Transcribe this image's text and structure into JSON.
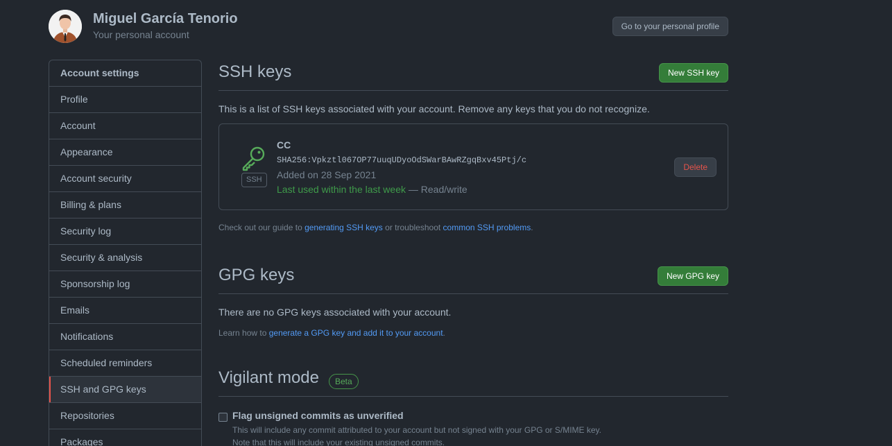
{
  "header": {
    "user_name": "Miguel García Tenorio",
    "subtitle": "Your personal account",
    "profile_button": "Go to your personal profile"
  },
  "sidebar": {
    "heading": "Account settings",
    "items": [
      {
        "label": "Profile"
      },
      {
        "label": "Account"
      },
      {
        "label": "Appearance"
      },
      {
        "label": "Account security"
      },
      {
        "label": "Billing & plans"
      },
      {
        "label": "Security log"
      },
      {
        "label": "Security & analysis"
      },
      {
        "label": "Sponsorship log"
      },
      {
        "label": "Emails"
      },
      {
        "label": "Notifications"
      },
      {
        "label": "Scheduled reminders"
      },
      {
        "label": "SSH and GPG keys",
        "active": true
      },
      {
        "label": "Repositories"
      },
      {
        "label": "Packages"
      }
    ]
  },
  "ssh": {
    "title": "SSH keys",
    "new_button": "New SSH key",
    "intro": "This is a list of SSH keys associated with your account. Remove any keys that you do not recognize.",
    "key": {
      "name": "CC",
      "fingerprint": "SHA256:Vpkztl067OP77uuqUDyoOdSWarBAwRZgqBxv45Ptj/c",
      "added": "Added on 28 Sep 2021",
      "last_used": "Last used within the last week",
      "access": " — Read/write",
      "type_label": "SSH",
      "delete_button": "Delete"
    },
    "note_prefix": "Check out our guide to ",
    "note_link1": "generating SSH keys",
    "note_middle": " or troubleshoot ",
    "note_link2": "common SSH problems",
    "note_suffix": "."
  },
  "gpg": {
    "title": "GPG keys",
    "new_button": "New GPG key",
    "empty": "There are no GPG keys associated with your account.",
    "note_prefix": "Learn how to ",
    "note_link": "generate a GPG key and add it to your account",
    "note_suffix": "."
  },
  "vigilant": {
    "title": "Vigilant mode",
    "badge": "Beta",
    "checkbox_label": "Flag unsigned commits as unverified",
    "desc_line1": "This will include any commit attributed to your account but not signed with your GPG or S/MIME key.",
    "desc_line2": "Note that this will include your existing unsigned commits.",
    "checked": false
  },
  "colors": {
    "background": "#22272e",
    "border": "#444c56",
    "accent_green": "#347d39",
    "link": "#539bf5",
    "danger": "#e5534b"
  }
}
